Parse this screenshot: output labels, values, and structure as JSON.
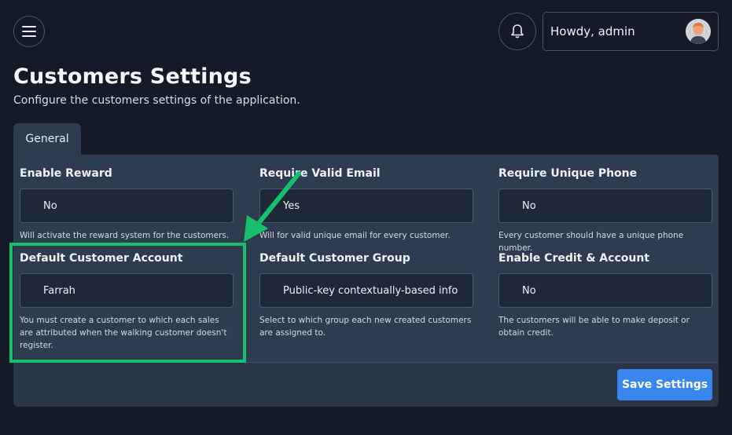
{
  "header": {
    "greeting": "Howdy, admin",
    "icons": {
      "menu": "hamburger-menu-icon",
      "notifications": "bell-icon",
      "avatar": "user-avatar"
    }
  },
  "page": {
    "title": "Customers Settings",
    "subtitle": "Configure the customers settings of the application."
  },
  "tabs": [
    {
      "label": "General",
      "active": true
    }
  ],
  "fields": {
    "enable_reward": {
      "label": "Enable Reward",
      "value": "No",
      "help": "Will activate the reward system for the customers."
    },
    "require_valid_email": {
      "label": "Require Valid Email",
      "value": "Yes",
      "help": "Will for valid unique email for every customer."
    },
    "require_unique_phone": {
      "label": "Require Unique Phone",
      "value": "No",
      "help": "Every customer should have a unique phone number."
    },
    "default_customer_account": {
      "label": "Default Customer Account",
      "value": "Farrah",
      "help": "You must create a customer to which each sales are attributed when the walking customer doesn't register."
    },
    "default_customer_group": {
      "label": "Default Customer Group",
      "value": "Public-key contextually-based info",
      "help": "Select to which group each new created customers are assigned to."
    },
    "enable_credit_account": {
      "label": "Enable Credit & Account",
      "value": "No",
      "help": "The customers will be able to make deposit or obtain credit."
    }
  },
  "actions": {
    "save_label": "Save Settings"
  },
  "colors": {
    "background": "#141a28",
    "panel": "#2f3b4f",
    "primary_button": "#3a86ef",
    "annotation_highlight": "#15c16b"
  }
}
